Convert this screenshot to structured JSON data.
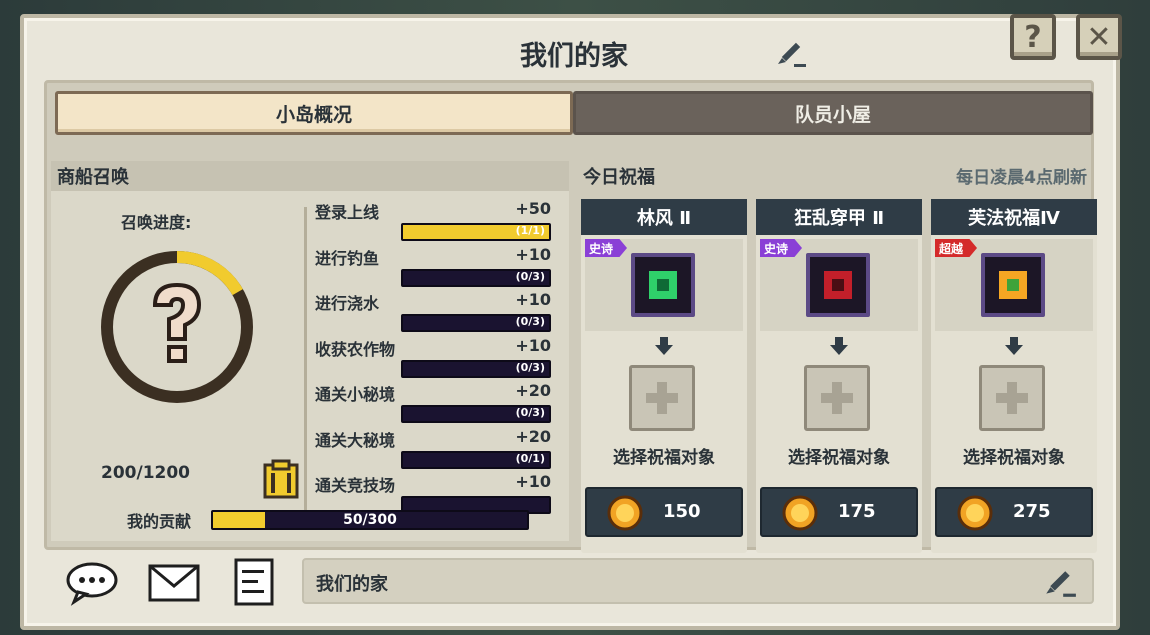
{
  "window": {
    "title": "我们的家",
    "help_label": "?",
    "close_label": "✕"
  },
  "tabs": [
    {
      "label": "小岛概况",
      "active": true
    },
    {
      "label": "队员小屋",
      "active": false
    }
  ],
  "merchant": {
    "heading": "商船召唤",
    "progress_label": "召唤进度:",
    "progress_value": "200/1200",
    "progress_fraction": 0.167,
    "tasks": [
      {
        "name": "登录上线",
        "points": "+50",
        "progress": "(1/1)",
        "fraction": 1.0
      },
      {
        "name": "进行钓鱼",
        "points": "+10",
        "progress": "(0/3)",
        "fraction": 0.0
      },
      {
        "name": "进行浇水",
        "points": "+10",
        "progress": "(0/3)",
        "fraction": 0.0
      },
      {
        "name": "收获农作物",
        "points": "+10",
        "progress": "(0/3)",
        "fraction": 0.0
      },
      {
        "name": "通关小秘境",
        "points": "+20",
        "progress": "(0/3)",
        "fraction": 0.0
      },
      {
        "name": "通关大秘境",
        "points": "+20",
        "progress": "(0/1)",
        "fraction": 0.0
      },
      {
        "name": "通关竞技场",
        "points": "+10",
        "progress": "",
        "fraction": 0.0
      }
    ],
    "contribution_label": "我的贡献",
    "contribution_value": "50/300",
    "contribution_fraction": 0.1667
  },
  "blessings": {
    "heading": "今日祝福",
    "refresh_note": "每日凌晨4点刷新",
    "cards": [
      {
        "name": "林风 Ⅱ",
        "rarity": "史诗",
        "rarity_color": "#8a3fd6",
        "slot_label": "选择祝福对象",
        "cost": "150"
      },
      {
        "name": "狂乱穿甲 Ⅱ",
        "rarity": "史诗",
        "rarity_color": "#8a3fd6",
        "slot_label": "选择祝福对象",
        "cost": "175"
      },
      {
        "name": "芙法祝福Ⅳ",
        "rarity": "超越",
        "rarity_color": "#d42a2a",
        "slot_label": "选择祝福对象",
        "cost": "275"
      }
    ]
  },
  "footer": {
    "home_name": "我们的家"
  },
  "icons": {
    "title_edit": "pencil-icon",
    "help": "question-icon",
    "close": "close-icon",
    "book": "book-icon",
    "coin": "coin-icon",
    "chat": "chat-icon",
    "mail": "mail-icon",
    "notes": "notes-icon"
  }
}
